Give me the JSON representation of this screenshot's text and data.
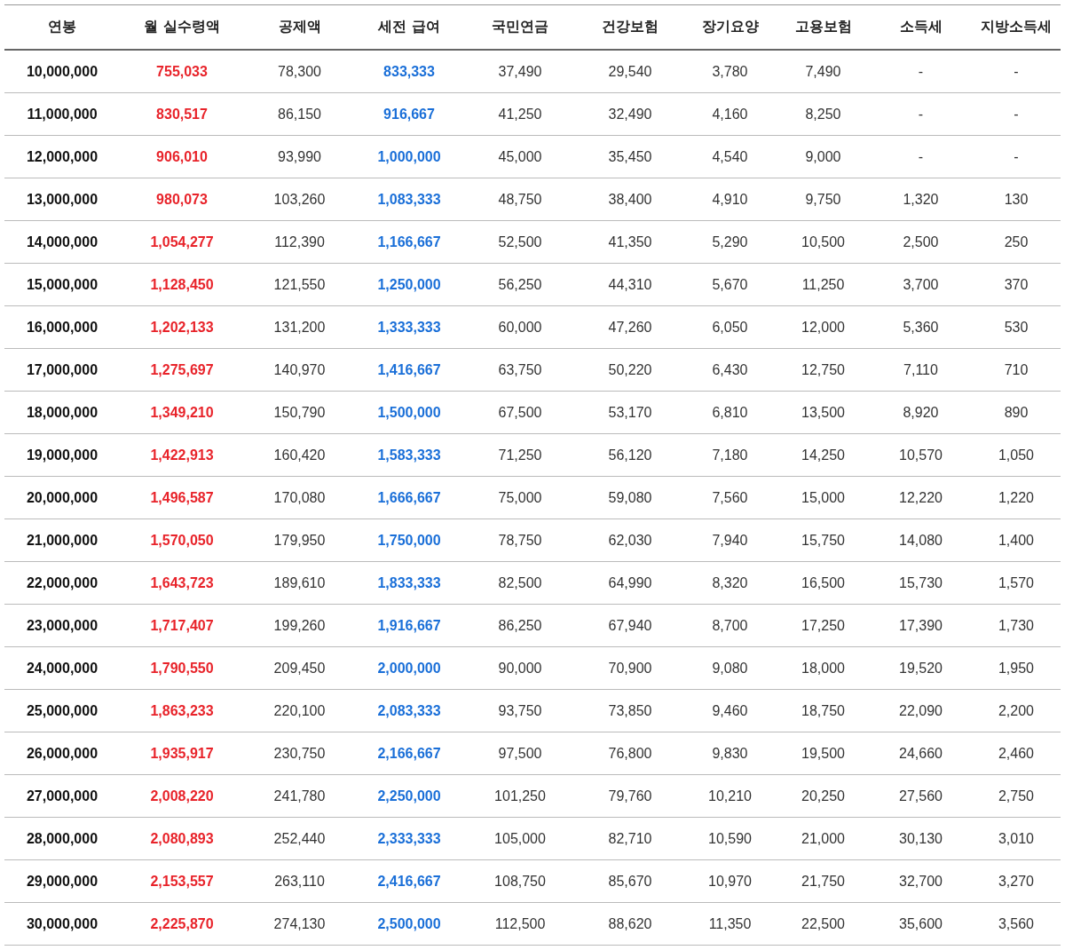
{
  "table": {
    "columns": [
      {
        "label": "연봉",
        "kind": "bold"
      },
      {
        "label": "월 실수령액",
        "kind": "net"
      },
      {
        "label": "공제액",
        "kind": "plain"
      },
      {
        "label": "세전 급여",
        "kind": "gross"
      },
      {
        "label": "국민연금",
        "kind": "plain"
      },
      {
        "label": "건강보험",
        "kind": "plain"
      },
      {
        "label": "장기요양",
        "kind": "plain"
      },
      {
        "label": "고용보험",
        "kind": "plain"
      },
      {
        "label": "소득세",
        "kind": "plain"
      },
      {
        "label": "지방소득세",
        "kind": "plain"
      }
    ],
    "rows": [
      [
        "10,000,000",
        "755,033",
        "78,300",
        "833,333",
        "37,490",
        "29,540",
        "3,780",
        "7,490",
        "-",
        "-"
      ],
      [
        "11,000,000",
        "830,517",
        "86,150",
        "916,667",
        "41,250",
        "32,490",
        "4,160",
        "8,250",
        "-",
        "-"
      ],
      [
        "12,000,000",
        "906,010",
        "93,990",
        "1,000,000",
        "45,000",
        "35,450",
        "4,540",
        "9,000",
        "-",
        "-"
      ],
      [
        "13,000,000",
        "980,073",
        "103,260",
        "1,083,333",
        "48,750",
        "38,400",
        "4,910",
        "9,750",
        "1,320",
        "130"
      ],
      [
        "14,000,000",
        "1,054,277",
        "112,390",
        "1,166,667",
        "52,500",
        "41,350",
        "5,290",
        "10,500",
        "2,500",
        "250"
      ],
      [
        "15,000,000",
        "1,128,450",
        "121,550",
        "1,250,000",
        "56,250",
        "44,310",
        "5,670",
        "11,250",
        "3,700",
        "370"
      ],
      [
        "16,000,000",
        "1,202,133",
        "131,200",
        "1,333,333",
        "60,000",
        "47,260",
        "6,050",
        "12,000",
        "5,360",
        "530"
      ],
      [
        "17,000,000",
        "1,275,697",
        "140,970",
        "1,416,667",
        "63,750",
        "50,220",
        "6,430",
        "12,750",
        "7,110",
        "710"
      ],
      [
        "18,000,000",
        "1,349,210",
        "150,790",
        "1,500,000",
        "67,500",
        "53,170",
        "6,810",
        "13,500",
        "8,920",
        "890"
      ],
      [
        "19,000,000",
        "1,422,913",
        "160,420",
        "1,583,333",
        "71,250",
        "56,120",
        "7,180",
        "14,250",
        "10,570",
        "1,050"
      ],
      [
        "20,000,000",
        "1,496,587",
        "170,080",
        "1,666,667",
        "75,000",
        "59,080",
        "7,560",
        "15,000",
        "12,220",
        "1,220"
      ],
      [
        "21,000,000",
        "1,570,050",
        "179,950",
        "1,750,000",
        "78,750",
        "62,030",
        "7,940",
        "15,750",
        "14,080",
        "1,400"
      ],
      [
        "22,000,000",
        "1,643,723",
        "189,610",
        "1,833,333",
        "82,500",
        "64,990",
        "8,320",
        "16,500",
        "15,730",
        "1,570"
      ],
      [
        "23,000,000",
        "1,717,407",
        "199,260",
        "1,916,667",
        "86,250",
        "67,940",
        "8,700",
        "17,250",
        "17,390",
        "1,730"
      ],
      [
        "24,000,000",
        "1,790,550",
        "209,450",
        "2,000,000",
        "90,000",
        "70,900",
        "9,080",
        "18,000",
        "19,520",
        "1,950"
      ],
      [
        "25,000,000",
        "1,863,233",
        "220,100",
        "2,083,333",
        "93,750",
        "73,850",
        "9,460",
        "18,750",
        "22,090",
        "2,200"
      ],
      [
        "26,000,000",
        "1,935,917",
        "230,750",
        "2,166,667",
        "97,500",
        "76,800",
        "9,830",
        "19,500",
        "24,660",
        "2,460"
      ],
      [
        "27,000,000",
        "2,008,220",
        "241,780",
        "2,250,000",
        "101,250",
        "79,760",
        "10,210",
        "20,250",
        "27,560",
        "2,750"
      ],
      [
        "28,000,000",
        "2,080,893",
        "252,440",
        "2,333,333",
        "105,000",
        "82,710",
        "10,590",
        "21,000",
        "30,130",
        "3,010"
      ],
      [
        "29,000,000",
        "2,153,557",
        "263,110",
        "2,416,667",
        "108,750",
        "85,670",
        "10,970",
        "21,750",
        "32,700",
        "3,270"
      ],
      [
        "30,000,000",
        "2,225,870",
        "274,130",
        "2,500,000",
        "112,500",
        "88,620",
        "11,350",
        "22,500",
        "35,600",
        "3,560"
      ]
    ]
  }
}
